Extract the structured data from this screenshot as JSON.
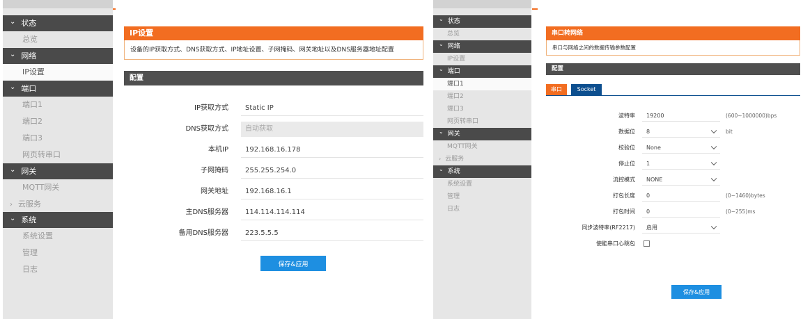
{
  "left": {
    "sidebar": {
      "groups": [
        {
          "label": "状态",
          "items": [
            {
              "label": "总览",
              "active": false
            }
          ]
        },
        {
          "label": "网络",
          "items": [
            {
              "label": "IP设置",
              "active": true
            }
          ]
        },
        {
          "label": "端口",
          "items": [
            {
              "label": "端口1",
              "active": false
            },
            {
              "label": "端口2",
              "active": false
            },
            {
              "label": "端口3",
              "active": false
            },
            {
              "label": "网页转串口",
              "active": false
            }
          ]
        },
        {
          "label": "网关",
          "items": [
            {
              "label": "MQTT网关",
              "active": false
            }
          ]
        },
        {
          "label": "云服务",
          "collapsed": true,
          "items": []
        },
        {
          "label": "系统",
          "items": [
            {
              "label": "系统设置",
              "active": false
            },
            {
              "label": "管理",
              "active": false
            },
            {
              "label": "日志",
              "active": false
            }
          ]
        }
      ]
    },
    "page": {
      "title": "IP设置",
      "description": "设备的IP获取方式、DNS获取方式、IP地址设置、子网掩码、网关地址以及DNS服务器地址配置",
      "section_title": "配置",
      "fields": [
        {
          "label": "IP获取方式",
          "value": "Static IP",
          "type": "select",
          "disabled": false
        },
        {
          "label": "DNS获取方式",
          "value": "自动获取",
          "type": "select",
          "disabled": true
        },
        {
          "label": "本机IP",
          "value": "192.168.16.178",
          "type": "text"
        },
        {
          "label": "子网掩码",
          "value": "255.255.254.0",
          "type": "text"
        },
        {
          "label": "网关地址",
          "value": "192.168.16.1",
          "type": "text"
        },
        {
          "label": "主DNS服务器",
          "value": "114.114.114.114",
          "type": "text"
        },
        {
          "label": "备用DNS服务器",
          "value": "223.5.5.5",
          "type": "text"
        }
      ],
      "save_label": "保存&应用"
    }
  },
  "right": {
    "sidebar": {
      "groups": [
        {
          "label": "状态",
          "items": [
            {
              "label": "总览",
              "active": false
            }
          ]
        },
        {
          "label": "网络",
          "items": [
            {
              "label": "IP设置",
              "active": false
            }
          ]
        },
        {
          "label": "端口",
          "items": [
            {
              "label": "端口1",
              "active": true
            },
            {
              "label": "端口2",
              "active": false
            },
            {
              "label": "端口3",
              "active": false
            },
            {
              "label": "网页转串口",
              "active": false
            }
          ]
        },
        {
          "label": "网关",
          "items": [
            {
              "label": "MQTT网关",
              "active": false
            }
          ]
        },
        {
          "label": "云服务",
          "collapsed": true,
          "items": []
        },
        {
          "label": "系统",
          "items": [
            {
              "label": "系统设置",
              "active": false
            },
            {
              "label": "管理",
              "active": false
            },
            {
              "label": "日志",
              "active": false
            }
          ]
        }
      ]
    },
    "page": {
      "title": "串口转网络",
      "description": "串口与网络之间的数据传输参数配置",
      "section_title": "配置",
      "tabs": [
        {
          "label": "串口",
          "active": true
        },
        {
          "label": "Socket",
          "active": false
        }
      ],
      "fields": [
        {
          "label": "波特率",
          "value": "19200",
          "type": "text",
          "hint": "(600~1000000)bps"
        },
        {
          "label": "数据位",
          "value": "8",
          "type": "select",
          "hint": "bit"
        },
        {
          "label": "校验位",
          "value": "None",
          "type": "select",
          "hint": ""
        },
        {
          "label": "停止位",
          "value": "1",
          "type": "select",
          "hint": ""
        },
        {
          "label": "流控模式",
          "value": "NONE",
          "type": "select",
          "hint": ""
        },
        {
          "label": "打包长度",
          "value": "0",
          "type": "text",
          "hint": "(0~1460)bytes"
        },
        {
          "label": "打包时间",
          "value": "0",
          "type": "text",
          "hint": "(0~255)ms"
        },
        {
          "label": "同步波特率(RF2217)",
          "value": "启用",
          "type": "select",
          "hint": ""
        },
        {
          "label": "使能串口心跳包",
          "value": "",
          "type": "checkbox",
          "hint": ""
        }
      ],
      "save_label": "保存&应用"
    }
  },
  "colors": {
    "accent": "#f26d21",
    "sidebar_dark": "#4a4a4a",
    "button": "#1e8fe1",
    "tab_inactive": "#0d4f8f"
  }
}
